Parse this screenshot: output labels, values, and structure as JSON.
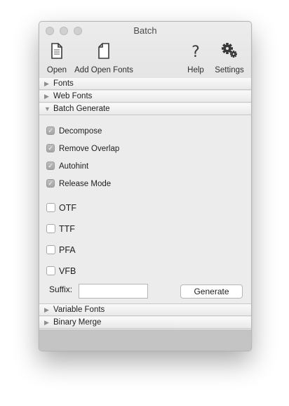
{
  "window": {
    "title": "Batch"
  },
  "toolbar": {
    "open_label": "Open",
    "add_open_fonts_label": "Add Open Fonts",
    "help_label": "Help",
    "help_glyph": "?",
    "settings_label": "Settings"
  },
  "sections": {
    "fonts": "Fonts",
    "web_fonts": "Web Fonts",
    "batch_generate": "Batch Generate",
    "variable_fonts": "Variable Fonts",
    "binary_merge": "Binary Merge"
  },
  "triangles": {
    "collapsed": "▶",
    "expanded": "▼"
  },
  "options": [
    {
      "label": "Decompose",
      "checked": true
    },
    {
      "label": "Remove Overlap",
      "checked": true
    },
    {
      "label": "Autohint",
      "checked": true
    },
    {
      "label": "Release Mode",
      "checked": true
    }
  ],
  "formats": [
    {
      "label": "OTF",
      "checked": false
    },
    {
      "label": "TTF",
      "checked": false
    },
    {
      "label": "PFA",
      "checked": false
    },
    {
      "label": "VFB",
      "checked": false
    }
  ],
  "checkmark": "✓",
  "suffix": {
    "label": "Suffix:",
    "value": ""
  },
  "generate_label": "Generate"
}
